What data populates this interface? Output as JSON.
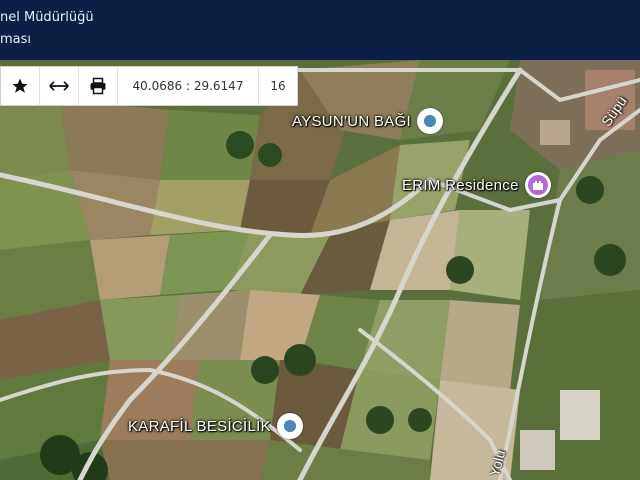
{
  "header": {
    "line1": "nel Müdürlüğü",
    "line2": "ması"
  },
  "toolbar": {
    "favorite_icon": "star-icon",
    "measure_icon": "horizontal-arrows-icon",
    "print_icon": "printer-icon",
    "coordinates": "40.0686 : 29.6147",
    "zoom": "16"
  },
  "map": {
    "pois": [
      {
        "label": "AYSUN'UN BAĞI",
        "icon": "map-pin-icon"
      },
      {
        "label": "ERIM Residence",
        "icon": "castle-pin-icon"
      },
      {
        "label": "KARAFİL BESİCİLİK",
        "icon": "map-pin-icon"
      }
    ],
    "road_labels": {
      "top_right": "Süpü",
      "bottom": "Yolu"
    },
    "colors": {
      "header_bg": "#0d1f45",
      "pin_blue": "#4a86b8",
      "pin_purple": "#b36bd4"
    }
  }
}
